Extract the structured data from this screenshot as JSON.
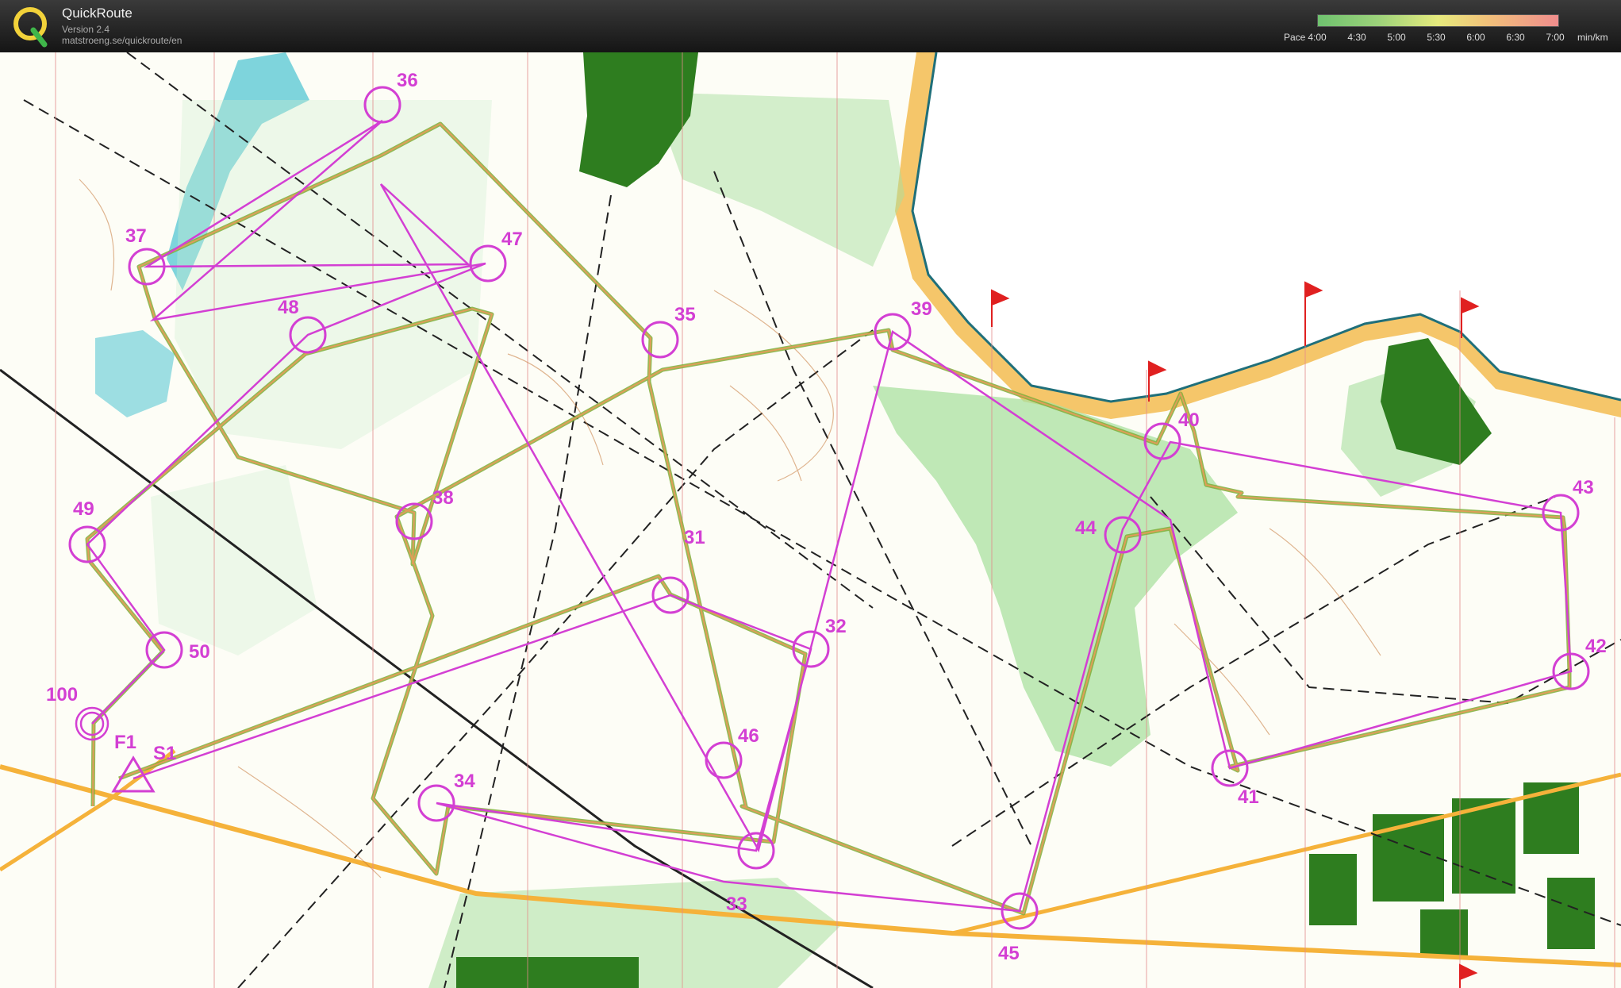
{
  "app": {
    "title": "QuickRoute",
    "version": "Version 2.4",
    "url": "matstroeng.se/quickroute/en"
  },
  "pace_legend": {
    "label": "Pace",
    "unit": "min/km",
    "ticks": [
      "4:00",
      "4:30",
      "5:00",
      "5:30",
      "6:00",
      "6:30",
      "7:00"
    ]
  },
  "colors": {
    "course": "#d33fd3",
    "route": "#7fae3a",
    "forest_dark": "#2e7d1f",
    "forest_light": "#a9e0a0",
    "water": "#5ec9d6",
    "open_land": "#f7d27a"
  },
  "controls": [
    {
      "label": "S1"
    },
    {
      "label": "31"
    },
    {
      "label": "32"
    },
    {
      "label": "33"
    },
    {
      "label": "34"
    },
    {
      "label": "35"
    },
    {
      "label": "36"
    },
    {
      "label": "37"
    },
    {
      "label": "38"
    },
    {
      "label": "39"
    },
    {
      "label": "40"
    },
    {
      "label": "41"
    },
    {
      "label": "42"
    },
    {
      "label": "43"
    },
    {
      "label": "44"
    },
    {
      "label": "45"
    },
    {
      "label": "46"
    },
    {
      "label": "47"
    },
    {
      "label": "48"
    },
    {
      "label": "49"
    },
    {
      "label": "50"
    },
    {
      "label": "100"
    },
    {
      "label": "F1"
    }
  ]
}
